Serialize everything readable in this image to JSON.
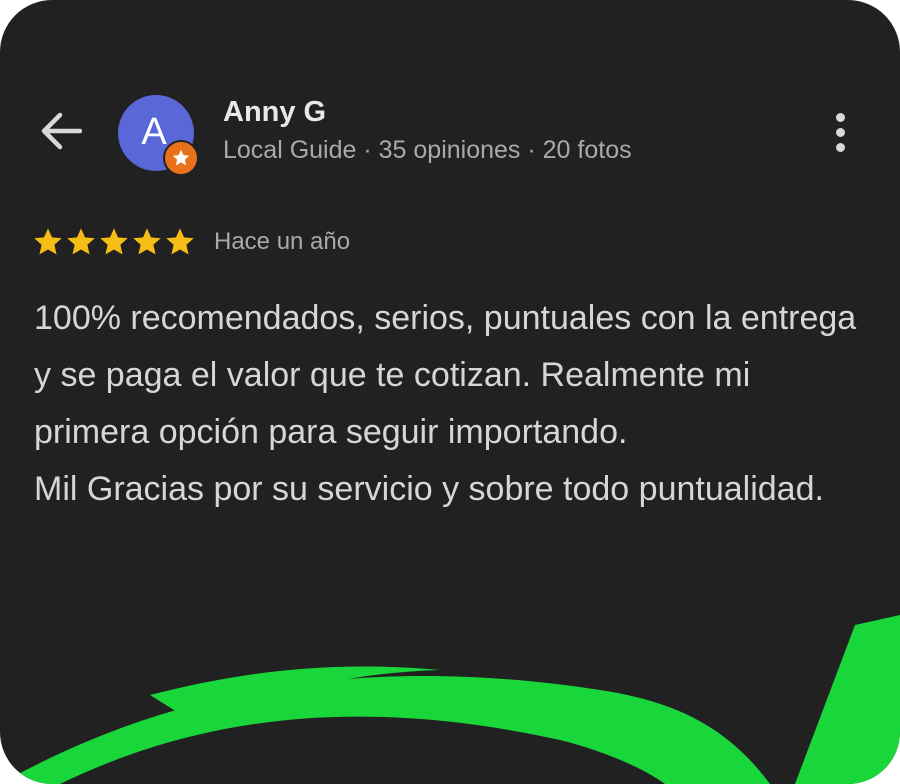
{
  "header": {
    "back_icon": "arrow-left-icon",
    "avatar_letter": "A",
    "badge_icon": "local-guide-star-icon",
    "user_name": "Anny G",
    "user_meta": "Local Guide · 35 opiniones · 20 fotos",
    "more_icon": "more-vertical-icon"
  },
  "review": {
    "rating": 5,
    "rating_max": 5,
    "time": "Hace un año",
    "paragraphs": [
      "100% recomendados, serios, puntuales con la entrega y se paga el valor que te cotizan. Realmente mi primera opción para seguir importando.",
      "Mil Gracias por su servicio y sobre todo puntualidad."
    ]
  },
  "colors": {
    "background": "#212121",
    "avatar": "#5967d8",
    "badge": "#e8711a",
    "star": "#f6bd16",
    "accent_green": "#19d63b"
  }
}
